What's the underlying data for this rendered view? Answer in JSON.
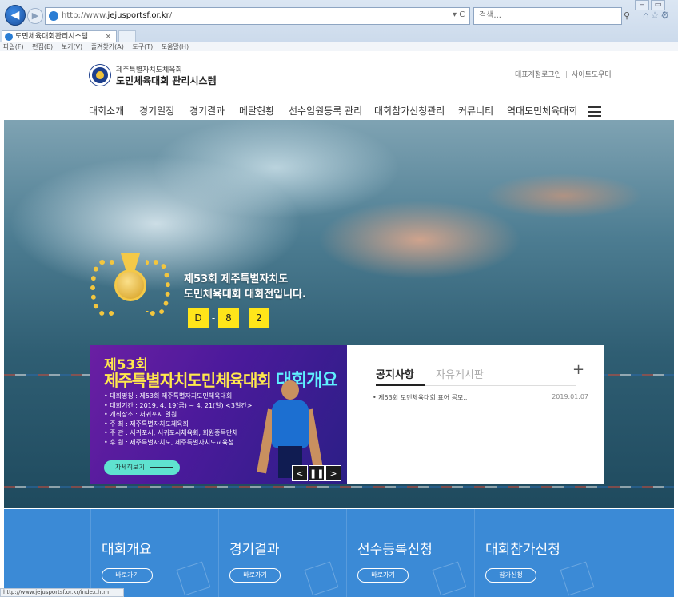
{
  "browser": {
    "address_prefix": "http://www.",
    "address_domain": "jejusportsf.or.kr",
    "address_suffix": "/",
    "address_tools": "▾ C",
    "search_placeholder": "검색...",
    "search_icon": "search-icon",
    "tab_title": "도민체육대회관리시스템",
    "tab_close": "×",
    "window_controls": [
      "‒",
      "▭",
      "✕"
    ],
    "menu": [
      "파일(F)",
      "편집(E)",
      "보기(V)",
      "즐겨찾기(A)",
      "도구(T)",
      "도움말(H)"
    ],
    "status_url": "http://www.jejusportsf.or.kr/index.htm"
  },
  "header": {
    "org_name": "제주특별자치도체육회",
    "system_name": "도민체육대회 관리시스템",
    "top_links": [
      "대표계정로그인",
      "사이트도우미"
    ],
    "top_links_sep": "|"
  },
  "nav": {
    "items": [
      "대회소개",
      "경기일정",
      "경기결과",
      "메달현황",
      "선수임원등록 관리",
      "대회참가신청관리",
      "커뮤니티",
      "역대도민체육대회"
    ]
  },
  "hero": {
    "title_line1": "제53회 제주특별자치도",
    "title_line2": "도민체육대회 대회전입니다.",
    "dday": [
      "D",
      "8",
      "2"
    ],
    "dday_sep": "-"
  },
  "banner": {
    "edition": "제53회",
    "headline_main": "제주특별자치도민체육대회",
    "headline_accent": "대회개요",
    "lines": [
      "• 대회명칭 : 제53회 제주특별자치도민체육대회",
      "• 대회기간 : 2019. 4. 19(금) ~ 4. 21(일) <3일간>",
      "• 개최장소 : 서귀포시 일원",
      "• 주 최 : 제주특별자치도체육회",
      "• 주 관 : 서귀포시, 서귀포시체육회, 회원종목단체",
      "• 후 원 : 제주특별자치도, 제주특별자치도교육청"
    ],
    "more_label": "자세히보기",
    "controls": [
      "<",
      "❚❚",
      ">"
    ]
  },
  "notice": {
    "tab_active": "공지사항",
    "tab_inactive": "자유게시판",
    "plus": "+",
    "items": [
      {
        "title": "• 제53회 도민체육대회 표어 공모..",
        "date": "2019.01.07"
      }
    ]
  },
  "quick_links": [
    {
      "title": "대회개요",
      "button": "바로가기"
    },
    {
      "title": "경기결과",
      "button": "바로가기"
    },
    {
      "title": "선수등록신청",
      "button": "바로가기"
    },
    {
      "title": "대회참가신청",
      "button": "참가신청"
    }
  ],
  "colors": {
    "quick_bg": "#3b8ad6",
    "banner_bg": "#4b1a9b",
    "dday_bg": "#ffe51a",
    "banner_headline": "#ffe84d",
    "banner_accent": "#5ff0ff"
  }
}
